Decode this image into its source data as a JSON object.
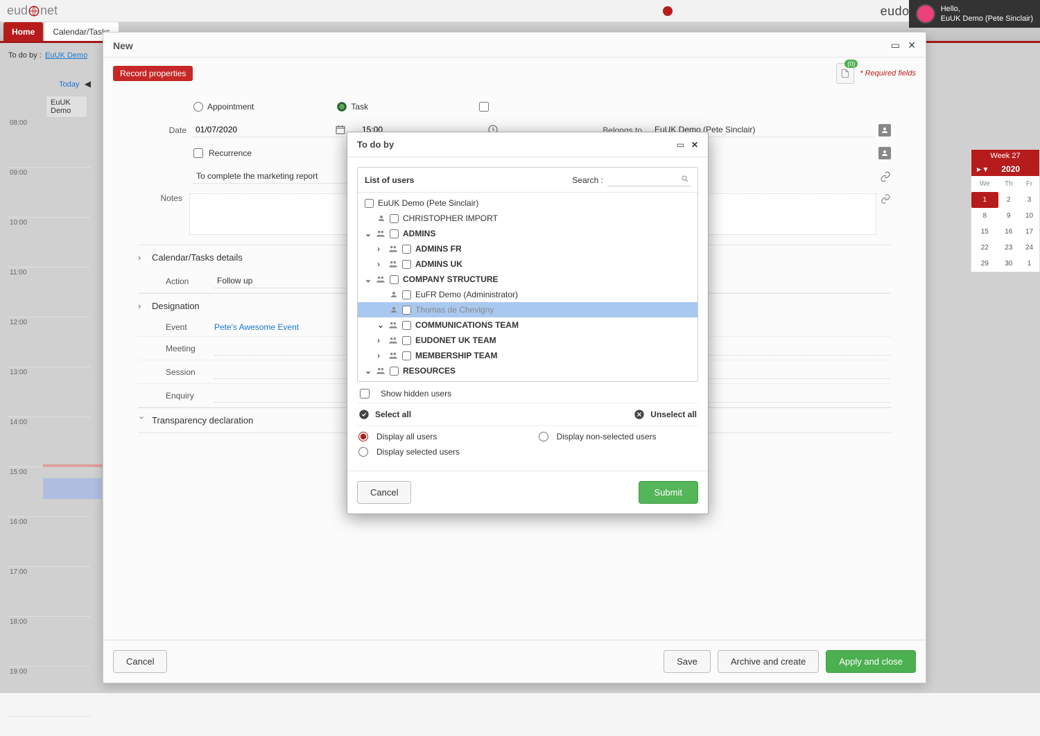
{
  "topbar": {
    "logo_left": "eud",
    "logo_right": "net",
    "brand_right": "eudonet",
    "greeting": "Hello,",
    "username": "EuUK Demo (Pete Sinclair)"
  },
  "tabs": {
    "home": "Home",
    "calendar": "Calendar/Tasks"
  },
  "left": {
    "todoby_label": "To do by :",
    "todoby_value": "EuUK Demo",
    "today": "Today",
    "owner": "EuUK Demo",
    "times": [
      "08:00",
      "09:00",
      "10:00",
      "11:00",
      "12:00",
      "13:00",
      "14:00",
      "15:00",
      "16:00",
      "17:00",
      "18:00",
      "19:00"
    ]
  },
  "rightcal": {
    "week": "Week 27",
    "year": "2020",
    "days": [
      "We",
      "Th",
      "Fr"
    ],
    "rows": [
      [
        "1",
        "2",
        "3"
      ],
      [
        "8",
        "9",
        "10"
      ],
      [
        "15",
        "16",
        "17"
      ],
      [
        "22",
        "23",
        "24"
      ],
      [
        "29",
        "30",
        "1"
      ]
    ]
  },
  "modal": {
    "title": "New",
    "record_badge": "Record properties",
    "attach_count": "(0)",
    "required_note": "* Required fields",
    "radio_appointment": "Appointment",
    "radio_task": "Task",
    "date_label": "Date",
    "date_value": "01/07/2020",
    "time_value": "15:00",
    "belongs_label": "Belongs to",
    "belongs_value": "EuUK Demo (Pete Sinclair)",
    "recurrence": "Recurrence",
    "subject_value": "To complete the marketing report",
    "notes_label": "Notes",
    "section_details": "Calendar/Tasks details",
    "action_label": "Action",
    "action_value": "Follow up",
    "section_designation": "Designation",
    "event_label": "Event",
    "event_value": "Pete's Awesome Event",
    "meeting_label": "Meeting",
    "session_label": "Session",
    "enquiry_label": "Enquiry",
    "section_transparency": "Transparency declaration",
    "footer": {
      "cancel": "Cancel",
      "save": "Save",
      "archive": "Archive and create",
      "apply": "Apply and close"
    }
  },
  "inner": {
    "title": "To do by",
    "list_title": "List of users",
    "search_label": "Search :",
    "tree": {
      "root_user": "EuUK Demo (Pete Sinclair)",
      "chris": "CHRISTOPHER IMPORT",
      "admins": "ADMINS",
      "admins_fr": "ADMINS FR",
      "admins_uk": "ADMINS UK",
      "company": "COMPANY STRUCTURE",
      "eufr": "EuFR Demo (Administrator)",
      "thomas": "Thomas de Chevigny",
      "comms": "COMMUNICATIONS TEAM",
      "ukteam": "EUDONET UK TEAM",
      "membership": "MEMBERSHIP TEAM",
      "resources": "RESOURCES"
    },
    "show_hidden": "Show hidden users",
    "select_all": "Select all",
    "unselect_all": "Unselect all",
    "opt_all": "Display all users",
    "opt_nonsel": "Display non-selected users",
    "opt_sel": "Display selected users",
    "cancel": "Cancel",
    "submit": "Submit"
  }
}
